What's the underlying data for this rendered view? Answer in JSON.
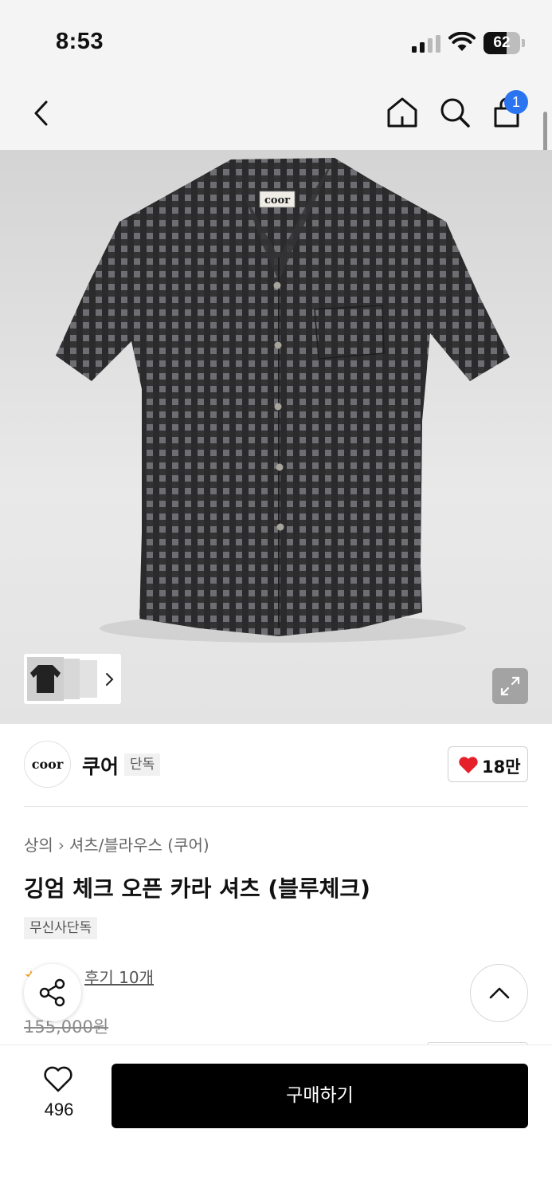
{
  "status_bar": {
    "time": "8:53",
    "battery_level": "62",
    "battery_fraction": 0.62
  },
  "nav": {
    "cart_count": "1",
    "icons": [
      "back-arrow-icon",
      "home-icon",
      "search-icon",
      "cart-icon"
    ]
  },
  "gallery": {
    "expand_icon": "expand-icon",
    "chevron_icon": "chevron-right-icon"
  },
  "product_image": {
    "label_text": "coor",
    "colors": {
      "shirt_dark": "#2e2e30",
      "shirt_check": "#5d5d60",
      "button": "#9a9890",
      "background_top": "#d4d4d4",
      "background_bottom": "#e9e9e9"
    }
  },
  "brand": {
    "logo_text": "coor",
    "name": "쿠어",
    "tag": "단독",
    "like_count": "18만",
    "like_color": "#e5202a"
  },
  "product": {
    "breadcrumb": [
      "상의",
      "셔츠/블라우스 (쿠어)"
    ],
    "title": "깅엄 체크 오픈 카라 셔츠 (블루체크)",
    "exclusive_tag": "무신사단독",
    "review_link": "후기 10개",
    "original_price": "155,000원"
  },
  "actions": {
    "share_icon": "share-icon",
    "scroll_top_icon": "chevron-up-icon",
    "wishlist_count": "496",
    "buy_label": "구매하기"
  }
}
